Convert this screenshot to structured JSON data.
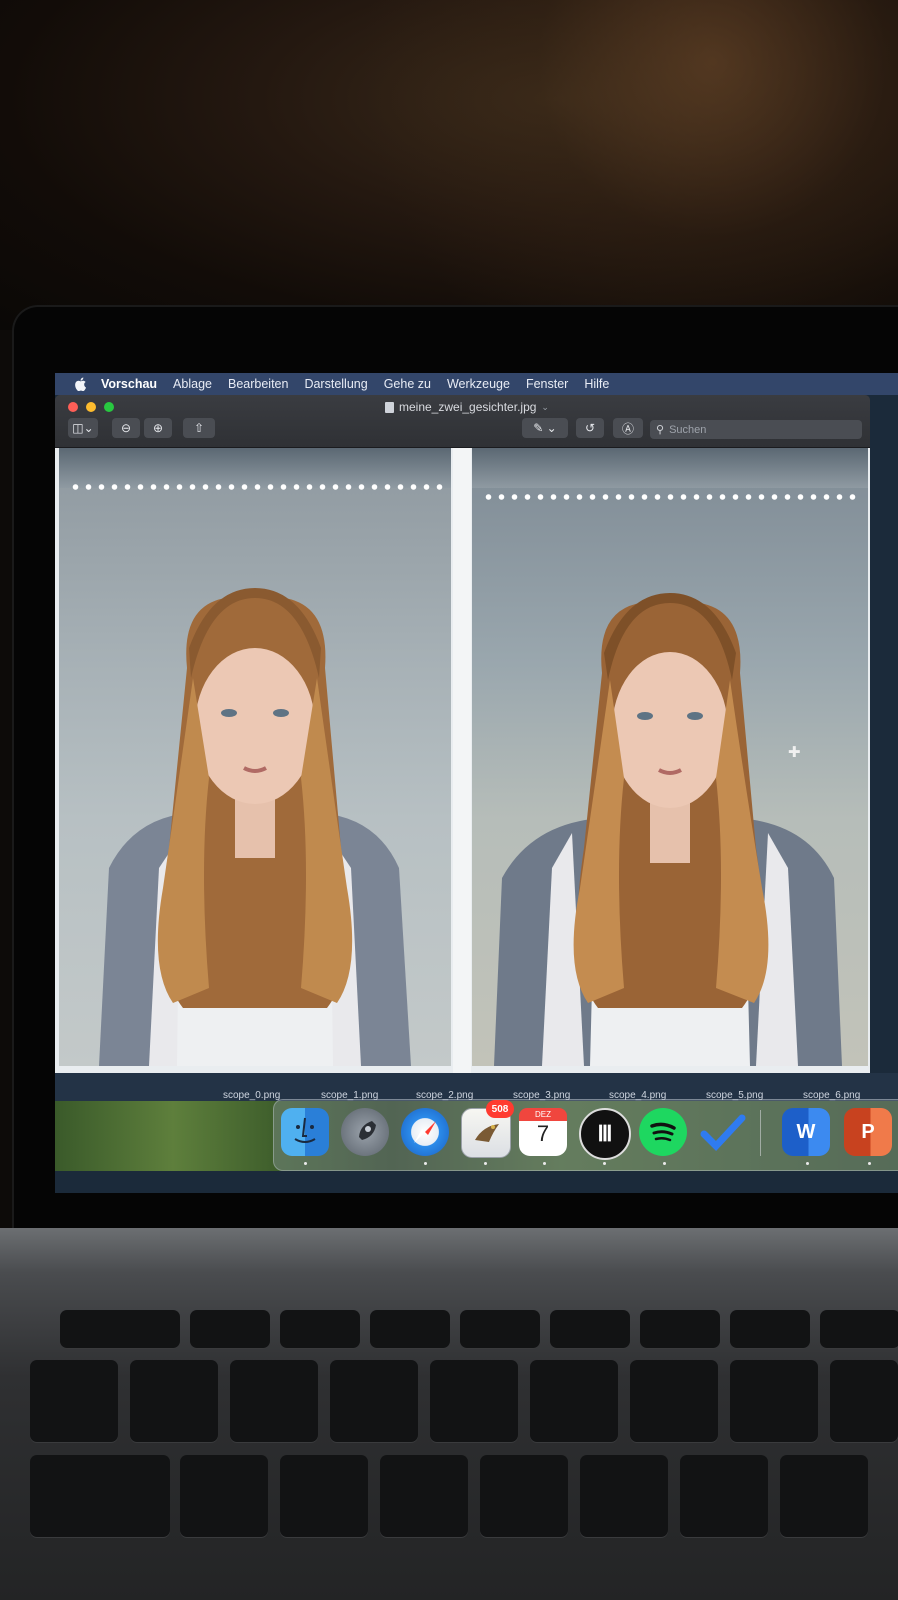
{
  "menubar": {
    "app_name": "Vorschau",
    "items": [
      "Ablage",
      "Bearbeiten",
      "Darstellung",
      "Gehe zu",
      "Werkzeuge",
      "Fenster",
      "Hilfe"
    ]
  },
  "window": {
    "title": "meine_zwei_gesichter.jpg",
    "search_placeholder": "Suchen"
  },
  "filenames": [
    "scope_0.png",
    "scope_1.png",
    "scope_2.png",
    "scope_3.png",
    "scope_4.png",
    "scope_5.png",
    "scope_6.png"
  ],
  "dock": {
    "mail_badge": "508",
    "calendar_month": "DEZ",
    "calendar_day": "7",
    "word_letter": "W",
    "powerpoint_letter": "P"
  },
  "icons": [
    "apple-icon",
    "sidebar-toggle-icon",
    "zoom-out-icon",
    "zoom-in-icon",
    "share-icon",
    "markup-pen-icon",
    "rotate-icon",
    "annotate-icon",
    "search-icon",
    "finder-icon",
    "launchpad-icon",
    "safari-icon",
    "mail-icon",
    "calendar-icon",
    "spotify-icon",
    "todo-icon",
    "word-icon",
    "powerpoint-icon"
  ],
  "colors": {
    "menubar_bg": "#33466a",
    "close": "#ff5f57",
    "minimize": "#febc2e",
    "maximize": "#28c840",
    "badge": "#ff3b30"
  }
}
